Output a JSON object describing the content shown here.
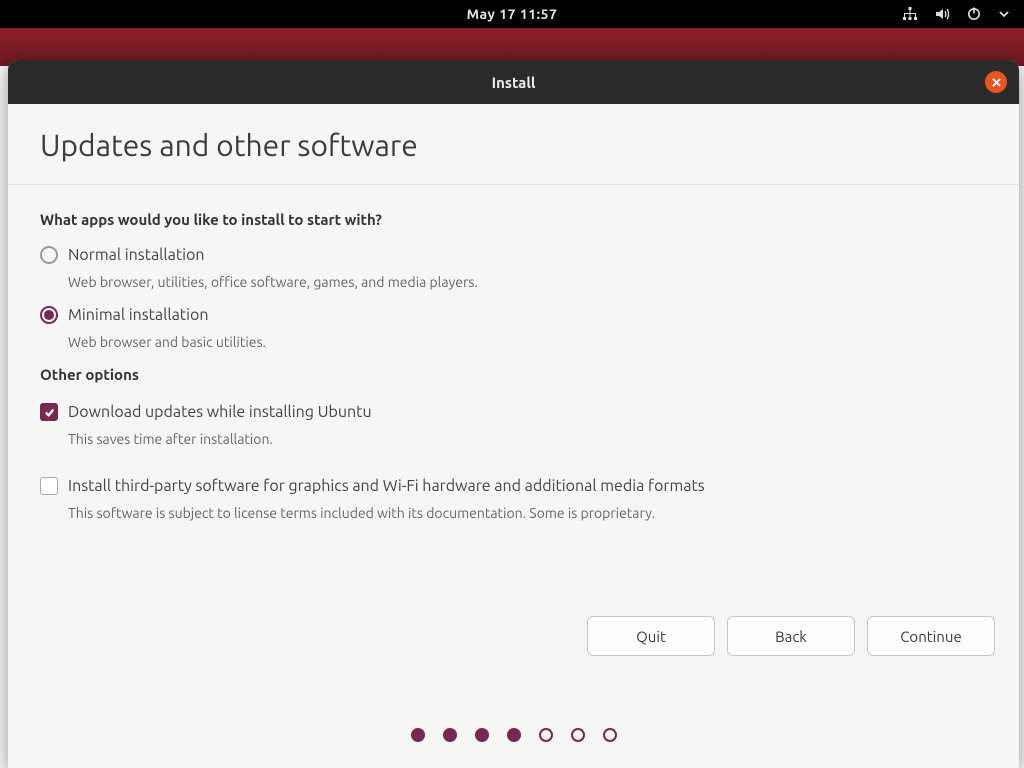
{
  "topbar": {
    "datetime": "May 17  11:57"
  },
  "titlebar": {
    "title": "Install"
  },
  "page": {
    "heading": "Updates and other software",
    "question": "What apps would you like to install to start with?",
    "options": {
      "normal": {
        "label": "Normal installation",
        "desc": "Web browser, utilities, office software, games, and media players.",
        "selected": false
      },
      "minimal": {
        "label": "Minimal installation",
        "desc": "Web browser and basic utilities.",
        "selected": true
      }
    },
    "other_heading": "Other options",
    "checkboxes": {
      "download_updates": {
        "label": "Download updates while installing Ubuntu",
        "desc": "This saves time after installation.",
        "checked": true
      },
      "third_party": {
        "label": "Install third-party software for graphics and Wi-Fi hardware and additional media formats",
        "desc": "This software is subject to license terms included with its documentation. Some is proprietary.",
        "checked": false
      }
    }
  },
  "footer": {
    "quit": "Quit",
    "back": "Back",
    "continue": "Continue"
  },
  "progress": {
    "total": 7,
    "current": 4
  },
  "colors": {
    "accent": "#772953",
    "ubuntu_orange": "#e95420"
  }
}
